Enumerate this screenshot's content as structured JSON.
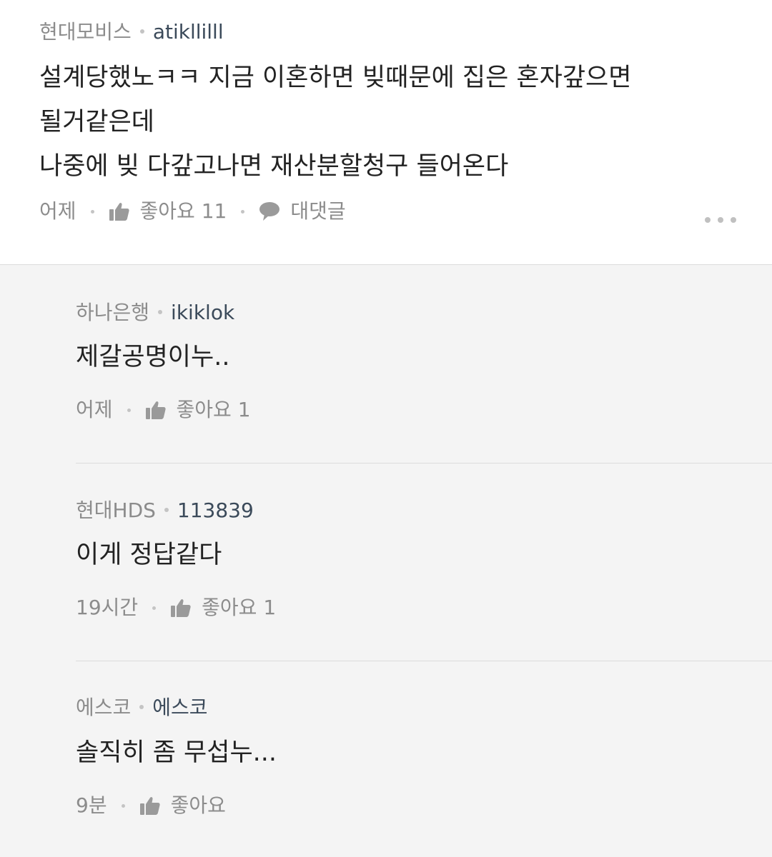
{
  "comments": [
    {
      "company": "현대모비스",
      "nickname": "atikllilll",
      "lines": [
        "설계당했노ㅋㅋ 지금 이혼하면 빚때문에 집은 혼자갚으면",
        "될거같은데",
        "나중에 빚 다갚고나면 재산분할청구 들어온다"
      ],
      "time": "어제",
      "like_label": "좋아요 11",
      "reply_label": "대댓글"
    }
  ],
  "replies": [
    {
      "company": "하나은행",
      "nickname": "ikiklok",
      "text": "제갈공명이누..",
      "time": "어제",
      "like_label": "좋아요 1"
    },
    {
      "company": "현대HDS",
      "nickname": "113839",
      "text": "이게 정답같다",
      "time": "19시간",
      "like_label": "좋아요 1"
    },
    {
      "company": "에스코",
      "nickname": "에스코",
      "text": "솔직히 좀 무섭누...",
      "time": "9분",
      "like_label": "좋아요"
    }
  ],
  "icons": {
    "like": "thumbs-up-icon",
    "reply": "speech-bubble-icon",
    "more": "more-dots-icon"
  },
  "colors": {
    "meta_gray": "#8c8c8c",
    "nickname": "#3b4a5a",
    "reply_background": "#f4f4f4"
  }
}
